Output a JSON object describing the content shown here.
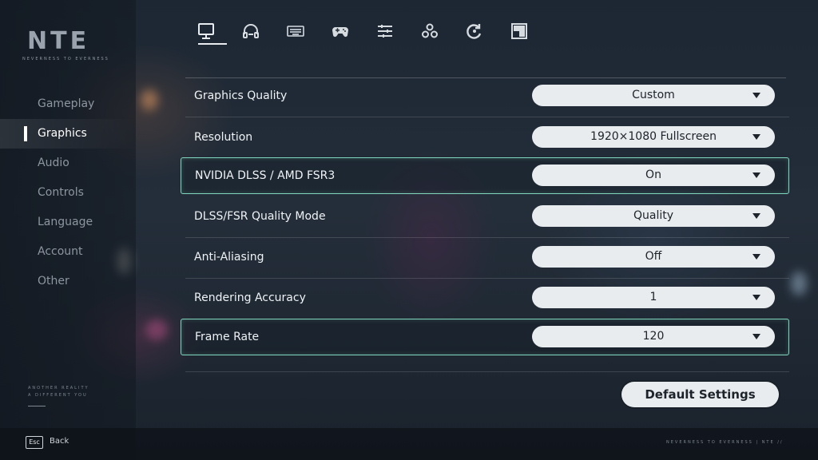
{
  "logo": {
    "title": "NTE",
    "subtitle": "NEVERNESS TO EVERNESS"
  },
  "sidebar": {
    "items": [
      {
        "label": "Gameplay",
        "active": false
      },
      {
        "label": "Graphics",
        "active": true
      },
      {
        "label": "Audio",
        "active": false
      },
      {
        "label": "Controls",
        "active": false
      },
      {
        "label": "Language",
        "active": false
      },
      {
        "label": "Account",
        "active": false
      },
      {
        "label": "Other",
        "active": false
      }
    ],
    "tagline_1": "ANOTHER REALITY",
    "tagline_2": "A DIFFERENT YOU"
  },
  "tabs": [
    {
      "icon": "monitor-icon",
      "active": true
    },
    {
      "icon": "headphones-icon",
      "active": false
    },
    {
      "icon": "keyboard-icon",
      "active": false
    },
    {
      "icon": "gamepad-icon",
      "active": false
    },
    {
      "icon": "sliders-icon",
      "active": false
    },
    {
      "icon": "network-icon",
      "active": false
    },
    {
      "icon": "refresh-icon",
      "active": false
    },
    {
      "icon": "layout-icon",
      "active": false
    }
  ],
  "settings": [
    {
      "label": "Graphics Quality",
      "value": "Custom",
      "highlight": false
    },
    {
      "label": "Resolution",
      "value": "1920×1080 Fullscreen",
      "highlight": false
    },
    {
      "label": "NVIDIA DLSS / AMD FSR3",
      "value": "On",
      "highlight": true
    },
    {
      "label": "DLSS/FSR Quality Mode",
      "value": "Quality",
      "highlight": false
    },
    {
      "label": "Anti-Aliasing",
      "value": "Off",
      "highlight": false
    },
    {
      "label": "Rendering Accuracy",
      "value": "1",
      "highlight": false
    },
    {
      "label": "Frame Rate",
      "value": "120",
      "highlight": true
    }
  ],
  "default_button": "Default Settings",
  "footer": {
    "esc_key": "Esc",
    "back_label": "Back",
    "brand": "NEVERNESS TO EVERNESS   |   NTE   //"
  },
  "colors": {
    "highlight_border": "#7fd6bd",
    "dropdown_bg": "#e9ecef"
  }
}
